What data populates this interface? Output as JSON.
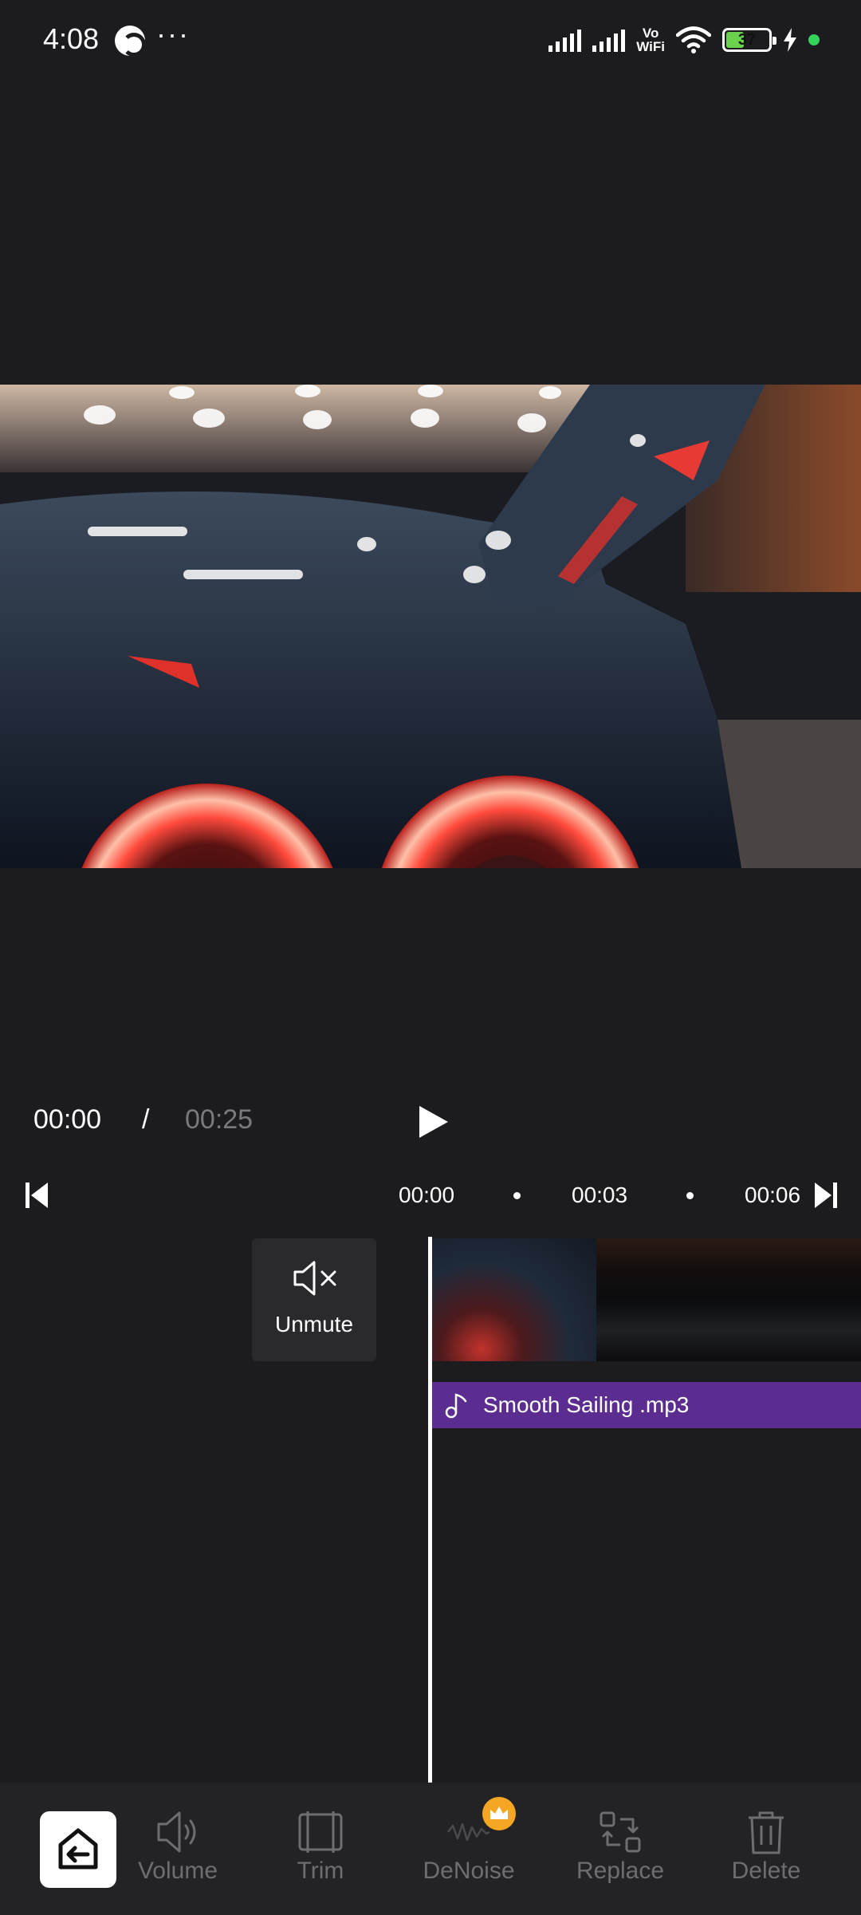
{
  "status_bar": {
    "time": "4:08",
    "more": "···",
    "vowifi_top": "Vo",
    "vowifi_bottom": "WiFi",
    "battery_level": "37"
  },
  "playback": {
    "current_time": "00:00",
    "separator": "/",
    "total_time": "00:25"
  },
  "ruler": {
    "labels": [
      "00:00",
      "00:03",
      "00:06"
    ]
  },
  "timeline": {
    "unmute_label": "Unmute",
    "audio_track_name": "Smooth Sailing .mp3"
  },
  "toolbar": {
    "items": [
      {
        "label": "Volume",
        "icon": "volume-icon"
      },
      {
        "label": "Trim",
        "icon": "trim-icon"
      },
      {
        "label": "DeNoise",
        "icon": "denoise-icon",
        "badge": "crown-icon"
      },
      {
        "label": "Replace",
        "icon": "replace-icon"
      },
      {
        "label": "Delete",
        "icon": "delete-icon"
      }
    ]
  },
  "colors": {
    "background": "#1c1c1e",
    "audio_track": "#5c2d91",
    "toolbar_label": "#6e6e72",
    "crown_badge": "#f5a623",
    "battery_fill": "#6ad24c"
  }
}
